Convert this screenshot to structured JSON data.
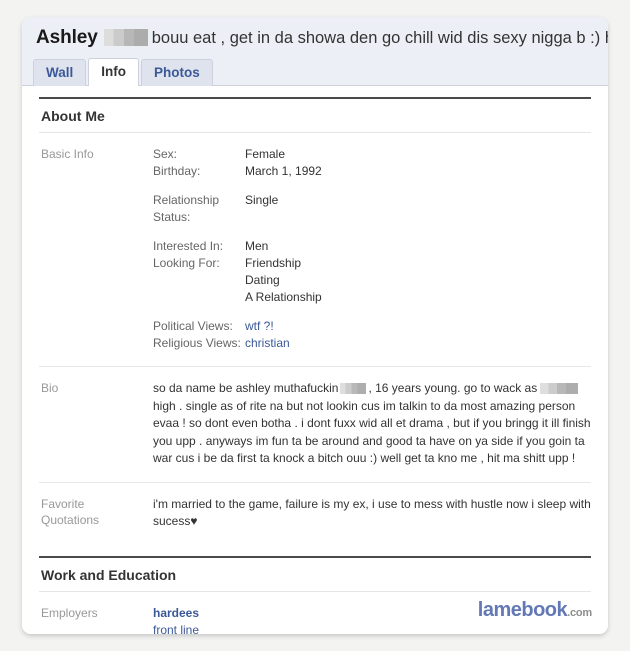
{
  "profile": {
    "name": "Ashley",
    "name_redacted": true,
    "status": "bouu eat , get in da showa den go chill wid dis sexy nigga b :) hit ma shitt uppp !"
  },
  "tabs": [
    {
      "label": "Wall",
      "active": false
    },
    {
      "label": "Info",
      "active": true
    },
    {
      "label": "Photos",
      "active": false
    }
  ],
  "sections": {
    "about_me": {
      "title": "About Me",
      "basic_info": {
        "label": "Basic Info",
        "sex_key": "Sex:",
        "sex_value": "Female",
        "birthday_key": "Birthday:",
        "birthday_value": "March 1, 1992",
        "relationship_key": "Relationship Status:",
        "relationship_value": "Single",
        "interested_key": "Interested In:",
        "interested_value": "Men",
        "looking_key": "Looking For:",
        "looking_value_1": "Friendship",
        "looking_value_2": "Dating",
        "looking_value_3": "A Relationship",
        "political_key": "Political Views:",
        "political_value": "wtf ?!",
        "religious_key": "Religious Views:",
        "religious_value": "christian"
      },
      "bio": {
        "label": "Bio",
        "text_part_1": "so da name be ashley muthafuckin",
        "text_part_2": ", 16 years young. go to wack as",
        "text_part_3": "high . single as of rite na but not lookin cus im talkin to da most amazing person evaa ! so dont even botha . i dont fuxx wid all et drama , but if you bringg it ill finish you upp . anyways im fun ta be around and good ta have on ya side if you goin ta war cus i be da first ta knock a bitch ouu :) well get ta kno me , hit ma shitt upp !"
      },
      "favorite_quotations": {
        "label_line_1": "Favorite",
        "label_line_2": "Quotations",
        "text": "i'm married to the game, failure is my ex, i use to mess with hustle now i sleep with sucess♥"
      }
    },
    "work_and_education": {
      "title": "Work and Education",
      "employers": {
        "label": "Employers",
        "name": "hardees",
        "role": "front line"
      }
    }
  },
  "watermark": {
    "name": "lamebook",
    "tld": ".com"
  },
  "colors": {
    "link": "#3b5998",
    "header_bg": "#eceff5",
    "tab_bg": "#dfe3ee",
    "label_gray": "#999999",
    "watermark_blue": "#6379b5"
  }
}
